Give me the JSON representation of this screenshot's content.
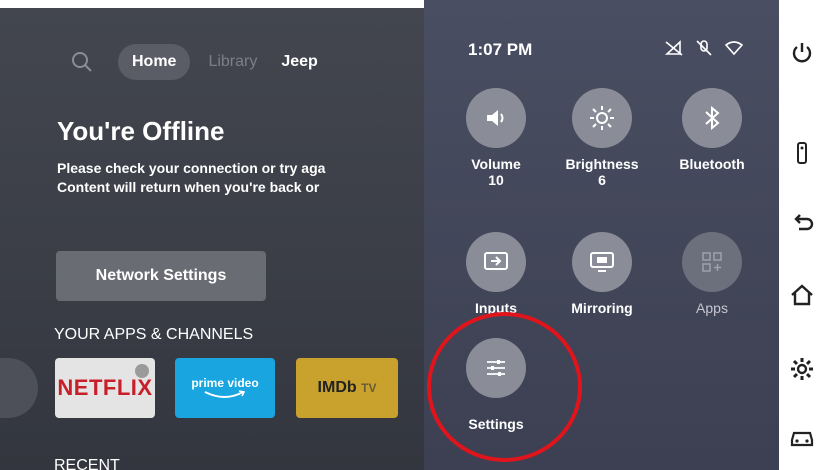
{
  "nav": {
    "home": "Home",
    "library": "Library",
    "jeep": "Jeep"
  },
  "offline": {
    "title": "You're Offline",
    "line1": "Please check your connection or try aga",
    "line2": "Content will return when you're back or"
  },
  "network_button": "Network Settings",
  "apps_section": "YOUR APPS & CHANNELS",
  "apps": {
    "netflix": "NETFLIX",
    "prime": "prime video",
    "imdb": "IMDb",
    "imdb_suffix": "TV"
  },
  "recent_label": "RECENT",
  "panel": {
    "time": "1:07 PM",
    "volume": {
      "label": "Volume",
      "value": "10"
    },
    "brightness": {
      "label": "Brightness",
      "value": "6"
    },
    "bluetooth": {
      "label": "Bluetooth"
    },
    "inputs": {
      "label": "Inputs"
    },
    "mirroring": {
      "label": "Mirroring"
    },
    "apps": {
      "label": "Apps"
    },
    "settings": {
      "label": "Settings"
    }
  },
  "colors": {
    "highlight_ring": "#e0151c",
    "netflix_red": "#c8202a",
    "prime_blue": "#19a5e0",
    "imdb_gold": "#c8a22d"
  }
}
